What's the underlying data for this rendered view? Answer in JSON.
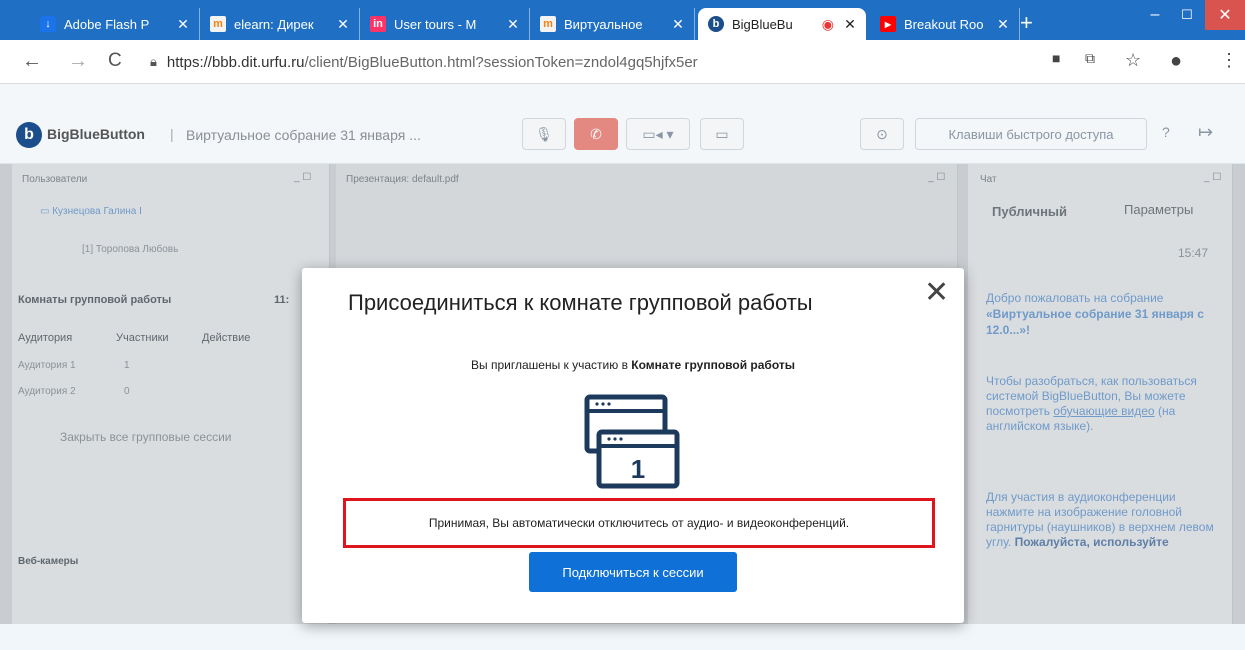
{
  "browser": {
    "tabs": [
      {
        "label": "Adobe Flash P",
        "icon": "download-icon",
        "color": "#1a73e8"
      },
      {
        "label": "elearn: Дирек",
        "icon": "moodle-icon",
        "color": "#f98012"
      },
      {
        "label": "User tours - M",
        "icon": "invision-icon",
        "color": "#ff3366"
      },
      {
        "label": "Виртуальное",
        "icon": "moodle-icon",
        "color": "#f98012"
      },
      {
        "label": "BigBlueBu",
        "icon": "bigbluebutton-icon",
        "color": "#1b4e8a"
      },
      {
        "label": "Breakout Roo",
        "icon": "youtube-icon",
        "color": "#ff0000"
      }
    ],
    "url_host": "https://bbb.dit.urfu.ru",
    "url_path": "/client/BigBlueButton.html?sessionToken=zndol4gq5hjfx5er"
  },
  "app": {
    "brand": "BigBlueButton",
    "meeting_title": "Виртуальное собрание 31 января ...",
    "shortcuts_label": "Клавиши быстрого доступа"
  },
  "users_panel": {
    "title": "Пользователи",
    "users": [
      "Кузнецова Галина І",
      "[1] Торопова Любовь"
    ],
    "breakout_title": "Комнаты групповой работы",
    "breakout_timer": "11:",
    "columns": [
      "Аудитория",
      "Участники",
      "Действие"
    ],
    "rooms": [
      {
        "name": "Аудитория 1",
        "count": "1"
      },
      {
        "name": "Аудитория 2",
        "count": "0"
      }
    ],
    "close_all": "Закрыть все групповые сессии",
    "webcams_title": "Веб-камеры"
  },
  "presentation_panel": {
    "title": "Презентация: default.pdf"
  },
  "chat_panel": {
    "title": "Чат",
    "tabs": [
      "Публичный",
      "Параметры"
    ],
    "time": "15:47",
    "welcome_prefix": "Добро пожаловать на собрание",
    "welcome_bold": "«Виртуальное собрание 31 января с 12.0...»!",
    "help_text": "Чтобы разобраться, как пользоваться системой BigBlueButton, Вы можете посмотреть",
    "help_link": "обучающие видео",
    "help_suffix": "(на английском языке).",
    "audio_text": "Для участия в аудиоконференции нажмите на изображение головной гарнитуры (наушников) в верхнем левом углу.",
    "audio_bold": "Пожалуйста, используйте"
  },
  "modal": {
    "title": "Присоединиться к комнате групповой работы",
    "invite_text": "Вы приглашены к участию в",
    "invite_bold": "Комнате групповой работы",
    "room_number": "1",
    "warning": "Принимая, Вы автоматически отключитесь от аудио- и видеоконференций.",
    "join_button": "Подключиться к сессии"
  },
  "colors": {
    "accent": "#0f70d7",
    "warning_border": "#e0141c"
  }
}
